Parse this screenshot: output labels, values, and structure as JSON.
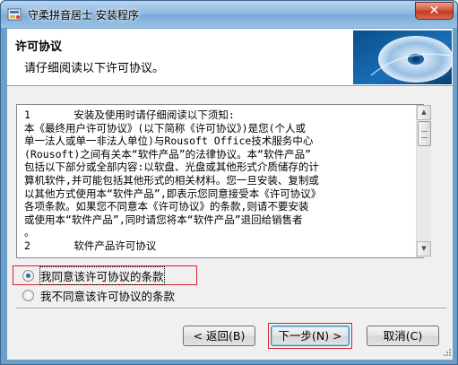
{
  "window": {
    "title": "守柔拼音居士 安装程序",
    "close_glyph": "✕"
  },
  "header": {
    "title": "许可协议",
    "subtitle": "请仔细阅读以下许可协议。"
  },
  "license": {
    "lines": [
      "1       安装及使用时请仔细阅读以下须知:",
      "本《最终用户许可协议》(以下简称《许可协议》)是您(个人或",
      "单一法人或单一非法人单位)与Rousoft Office技术服务中心",
      "(Rousoft)之间有关本“软件产品”的法律协议。本“软件产品”",
      "包括以下部分或全部内容:以软盘、光盘或其他形式介质储存的计",
      "算机软件,并可能包括其他形式的相关材料。您一旦安装、复制或",
      "以其他方式使用本“软件产品”,即表示您同意接受本《许可协议》",
      "各项条款。如果您不同意本《许可协议》的条款,则请不要安装",
      "或使用本“软件产品”,同时请您将本“软件产品”退回给销售者",
      "。",
      "2       软件产品许可协议"
    ]
  },
  "radios": {
    "accept_label": "我同意该许可协议的条款",
    "decline_label": "我不同意该许可协议的条款",
    "selected": "accept"
  },
  "buttons": {
    "back": "< 返回(B)",
    "next": "下一步(N) >",
    "cancel": "取消(C)"
  },
  "colors": {
    "titlebar": "#8fb9e0",
    "highlight_box": "#d8222a",
    "radio_dot": "#2c6fb2"
  }
}
